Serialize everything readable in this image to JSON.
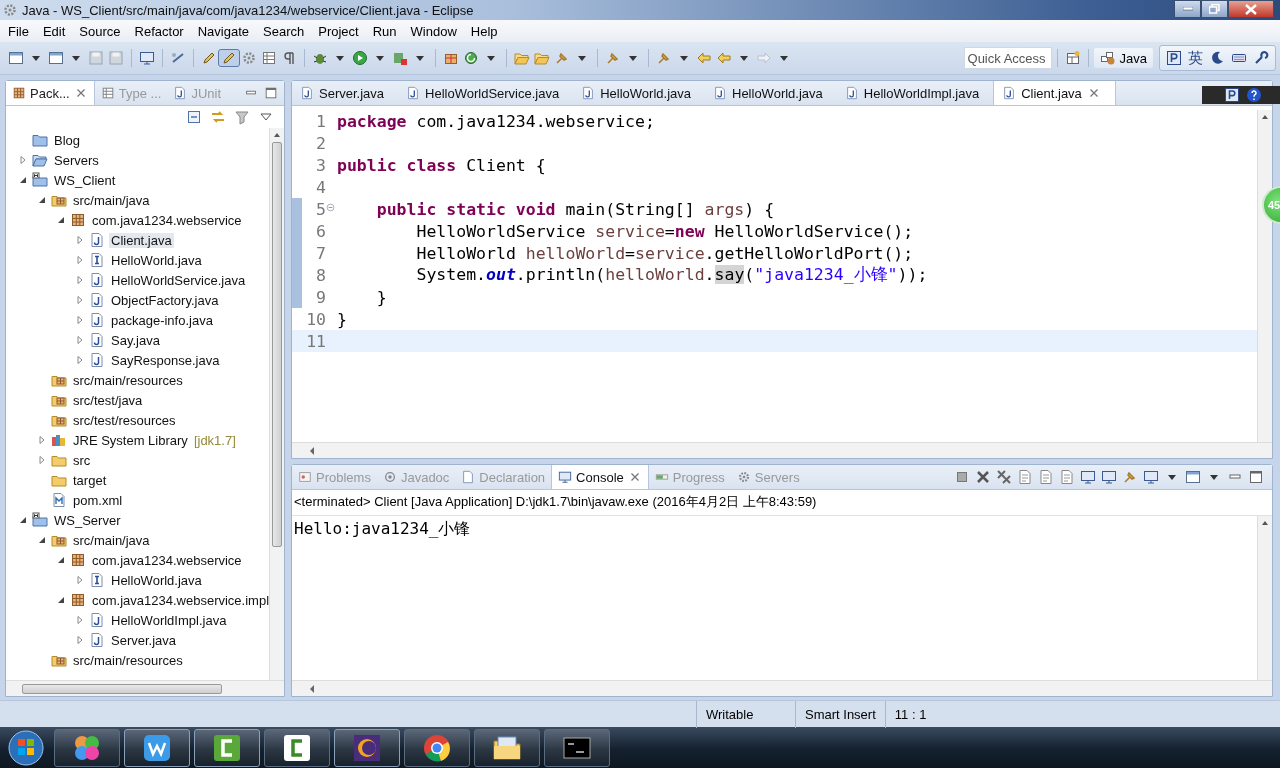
{
  "window": {
    "title": "Java - WS_Client/src/main/java/com/java1234/webservice/Client.java - Eclipse"
  },
  "menu": [
    "File",
    "Edit",
    "Source",
    "Refactor",
    "Navigate",
    "Search",
    "Project",
    "Run",
    "Window",
    "Help"
  ],
  "toolbar": {
    "quick_access": {
      "placeholder": "Quick Access"
    },
    "perspective": {
      "label": "Java",
      "selected": true
    },
    "ime": {
      "label": "英"
    }
  },
  "package_explorer": {
    "tabs": [
      {
        "label": "Pack...",
        "selected": true
      },
      {
        "label": "Type ...",
        "selected": false
      },
      {
        "label": "JUnit",
        "selected": false
      }
    ],
    "tree": [
      {
        "label": "Blog",
        "kind": "closed-project",
        "expandable": false,
        "selected": false
      },
      {
        "label": "Servers",
        "kind": "open-project",
        "expandable": true,
        "expanded": false,
        "selected": false
      },
      {
        "label": "WS_Client",
        "kind": "maven-project",
        "expandable": true,
        "expanded": true,
        "selected": false,
        "children": [
          {
            "label": "src/main/java",
            "kind": "source-folder",
            "expandable": true,
            "expanded": true,
            "selected": false,
            "children": [
              {
                "label": "com.java1234.webservice",
                "kind": "package",
                "expandable": true,
                "expanded": true,
                "selected": false,
                "children": [
                  {
                    "label": "Client.java",
                    "kind": "class",
                    "expandable": true,
                    "expanded": false,
                    "selected": true
                  },
                  {
                    "label": "HelloWorld.java",
                    "kind": "interface",
                    "expandable": true,
                    "expanded": false,
                    "selected": false
                  },
                  {
                    "label": "HelloWorldService.java",
                    "kind": "class",
                    "expandable": true,
                    "expanded": false,
                    "selected": false
                  },
                  {
                    "label": "ObjectFactory.java",
                    "kind": "class",
                    "expandable": true,
                    "expanded": false,
                    "selected": false
                  },
                  {
                    "label": "package-info.java",
                    "kind": "class",
                    "expandable": true,
                    "expanded": false,
                    "selected": false
                  },
                  {
                    "label": "Say.java",
                    "kind": "class",
                    "expandable": true,
                    "expanded": false,
                    "selected": false
                  },
                  {
                    "label": "SayResponse.java",
                    "kind": "class",
                    "expandable": true,
                    "expanded": false,
                    "selected": false
                  }
                ]
              }
            ]
          },
          {
            "label": "src/main/resources",
            "kind": "source-folder",
            "expandable": false,
            "selected": false
          },
          {
            "label": "src/test/java",
            "kind": "source-folder",
            "expandable": false,
            "selected": false
          },
          {
            "label": "src/test/resources",
            "kind": "source-folder",
            "expandable": false,
            "selected": false
          },
          {
            "label": "JRE System Library",
            "decoration": "[jdk1.7]",
            "kind": "library",
            "expandable": true,
            "expanded": false,
            "selected": false
          },
          {
            "label": "src",
            "kind": "folder",
            "expandable": true,
            "expanded": false,
            "selected": false
          },
          {
            "label": "target",
            "kind": "folder",
            "expandable": false,
            "selected": false
          },
          {
            "label": "pom.xml",
            "kind": "xml",
            "expandable": false,
            "selected": false
          }
        ]
      },
      {
        "label": "WS_Server",
        "kind": "maven-project",
        "expandable": true,
        "expanded": true,
        "selected": false,
        "children": [
          {
            "label": "src/main/java",
            "kind": "source-folder",
            "expandable": true,
            "expanded": true,
            "selected": false,
            "children": [
              {
                "label": "com.java1234.webservice",
                "kind": "package",
                "expandable": true,
                "expanded": true,
                "selected": false,
                "children": [
                  {
                    "label": "HelloWorld.java",
                    "kind": "interface",
                    "expandable": true,
                    "expanded": false,
                    "selected": false
                  }
                ]
              },
              {
                "label": "com.java1234.webservice.impl",
                "kind": "package",
                "expandable": true,
                "expanded": true,
                "selected": false,
                "children": [
                  {
                    "label": "HelloWorldImpl.java",
                    "kind": "class",
                    "expandable": true,
                    "expanded": false,
                    "selected": false
                  },
                  {
                    "label": "Server.java",
                    "kind": "class",
                    "expandable": true,
                    "expanded": false,
                    "selected": false
                  }
                ]
              }
            ]
          },
          {
            "label": "src/main/resources",
            "kind": "source-folder",
            "expandable": false,
            "selected": false
          }
        ]
      }
    ]
  },
  "editor": {
    "tabs": [
      {
        "label": "Server.java",
        "selected": false
      },
      {
        "label": "HelloWorldService.java",
        "selected": false
      },
      {
        "label": "HelloWorld.java",
        "selected": false
      },
      {
        "label": "HelloWorld.java",
        "selected": false
      },
      {
        "label": "HelloWorldImpl.java",
        "selected": false
      },
      {
        "label": "Client.java",
        "selected": true
      }
    ],
    "lines": [
      {
        "number": "1",
        "changed": false,
        "fold": false,
        "current": false,
        "tokens": [
          {
            "kind": "keyword",
            "text": "package"
          },
          {
            "kind": "plain",
            "text": " com.java1234.webservice;"
          }
        ]
      },
      {
        "number": "2",
        "changed": false,
        "fold": false,
        "current": false
      },
      {
        "number": "3",
        "changed": false,
        "fold": false,
        "current": false,
        "tokens": [
          {
            "kind": "keyword",
            "text": "public class"
          },
          {
            "kind": "plain",
            "text": " Client {"
          }
        ]
      },
      {
        "number": "4",
        "changed": false,
        "fold": false,
        "current": false
      },
      {
        "number": "5",
        "changed": true,
        "fold": true,
        "current": false,
        "tokens": [
          {
            "kind": "keyword",
            "text": "    public static void"
          },
          {
            "kind": "plain",
            "text": " main(String[] "
          },
          {
            "kind": "variable",
            "text": "args"
          },
          {
            "kind": "plain",
            "text": ") {"
          }
        ]
      },
      {
        "number": "6",
        "changed": true,
        "fold": false,
        "current": false,
        "tokens": [
          {
            "kind": "plain",
            "text": "        HelloWorldService "
          },
          {
            "kind": "variable",
            "text": "service"
          },
          {
            "kind": "plain",
            "text": "="
          },
          {
            "kind": "keyword",
            "text": "new"
          },
          {
            "kind": "plain",
            "text": " HelloWorldService();"
          }
        ]
      },
      {
        "number": "7",
        "changed": true,
        "fold": false,
        "current": false,
        "tokens": [
          {
            "kind": "plain",
            "text": "        HelloWorld "
          },
          {
            "kind": "variable",
            "text": "helloWorld"
          },
          {
            "kind": "plain",
            "text": "="
          },
          {
            "kind": "variable",
            "text": "service"
          },
          {
            "kind": "plain",
            "text": ".getHelloWorldPort();"
          }
        ]
      },
      {
        "number": "8",
        "changed": true,
        "fold": false,
        "current": false,
        "tokens": [
          {
            "kind": "plain",
            "text": "        System."
          },
          {
            "kind": "static-field",
            "text": "out"
          },
          {
            "kind": "plain",
            "text": ".println("
          },
          {
            "kind": "variable",
            "text": "helloWorld"
          },
          {
            "kind": "plain",
            "text": "."
          },
          {
            "kind": "occurrence",
            "text": "say"
          },
          {
            "kind": "plain",
            "text": "("
          },
          {
            "kind": "string",
            "text": "\"java1234_小锋\""
          },
          {
            "kind": "plain",
            "text": "));"
          }
        ]
      },
      {
        "number": "9",
        "changed": true,
        "fold": false,
        "current": false,
        "tokens": [
          {
            "kind": "plain",
            "text": "    }"
          }
        ]
      },
      {
        "number": "10",
        "changed": false,
        "fold": false,
        "current": false,
        "tokens": [
          {
            "kind": "plain",
            "text": "}"
          }
        ]
      },
      {
        "number": "11",
        "changed": false,
        "fold": false,
        "current": true
      }
    ]
  },
  "console": {
    "tabs": [
      {
        "label": "Problems",
        "kind": "problems",
        "selected": false
      },
      {
        "label": "Javadoc",
        "kind": "at",
        "selected": false
      },
      {
        "label": "Declaration",
        "kind": "page",
        "selected": false
      },
      {
        "label": "Console",
        "kind": "monitor",
        "selected": true
      },
      {
        "label": "Progress",
        "kind": "bar",
        "selected": false
      },
      {
        "label": "Servers",
        "kind": "gear",
        "selected": false
      }
    ],
    "header": "<terminated> Client [Java Application] D:\\jdk1.7\\bin\\javaw.exe (2016年4月2日 上午8:43:59)",
    "output": "Hello:java1234_小锋"
  },
  "status_bar": [
    "Writable",
    "Smart Insert",
    "11 : 1"
  ],
  "badge": "45"
}
